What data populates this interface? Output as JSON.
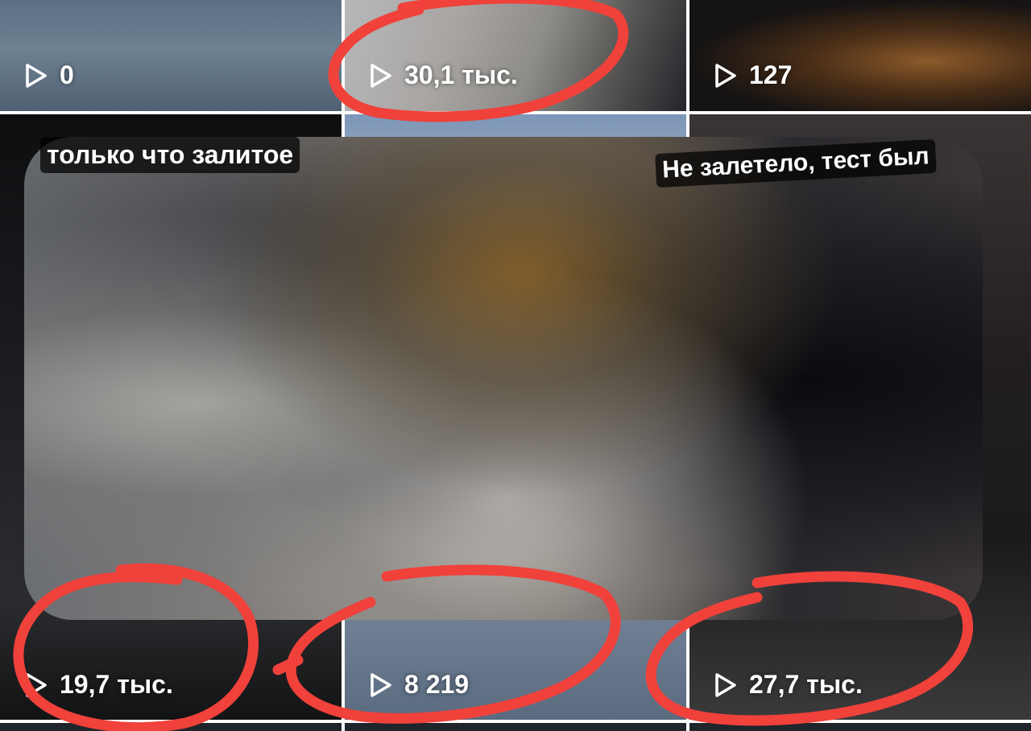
{
  "grid": {
    "tiles": [
      {
        "views": "0",
        "play_icon": "play-icon"
      },
      {
        "views": "30,1 тыс.",
        "play_icon": "play-icon"
      },
      {
        "views": "127",
        "play_icon": "play-icon"
      },
      {
        "views": "19,7 тыс.",
        "play_icon": "play-icon",
        "caption": "только что залитое"
      },
      {
        "views": "8 219",
        "play_icon": "play-icon"
      },
      {
        "views": "27,7 тыс.",
        "play_icon": "play-icon",
        "caption": "Не залетело, тест был"
      }
    ]
  },
  "annotations": {
    "highlight_color": "#f0413b",
    "circled": [
      "30,1 тыс.",
      "19,7 тыс.",
      "8 219",
      "27,7 тыс."
    ]
  }
}
